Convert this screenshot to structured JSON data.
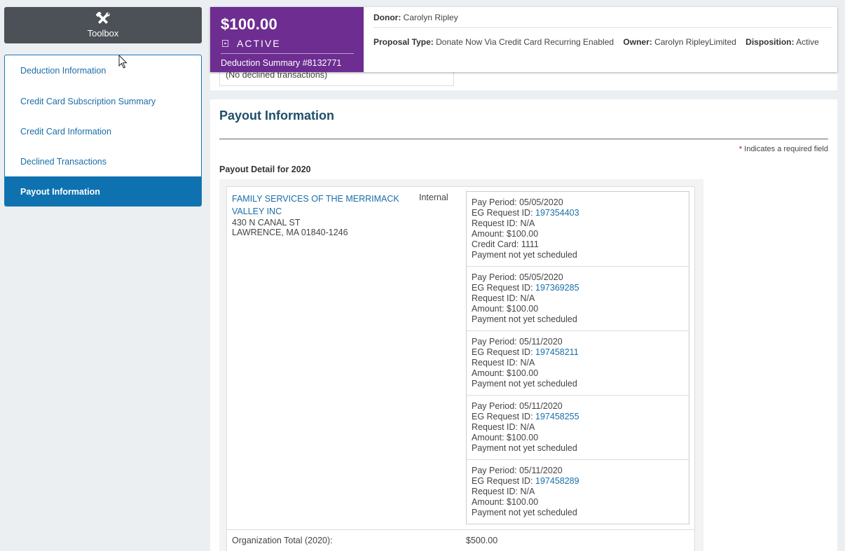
{
  "toolbox": {
    "label": "Toolbox"
  },
  "sidebar": {
    "items": [
      {
        "label": "Deduction Information",
        "active": false
      },
      {
        "label": "Credit Card Subscription Summary",
        "active": false
      },
      {
        "label": "Credit Card Information",
        "active": false
      },
      {
        "label": "Declined Transactions",
        "active": false
      },
      {
        "label": "Payout Information",
        "active": true
      }
    ]
  },
  "summary": {
    "amount": "$100.00",
    "status": "ACTIVE",
    "deduction_label": "Deduction Summary",
    "deduction_id": "#8132771",
    "donor_label": "Donor:",
    "donor": "Carolyn Ripley",
    "proposal_type_label": "Proposal Type:",
    "proposal_type": "Donate Now Via Credit Card Recurring Enabled",
    "owner_label": "Owner:",
    "owner": "Carolyn RipleyLimited",
    "disposition_label": "Disposition:",
    "disposition": "Active"
  },
  "declined": {
    "message": "(No declined transactions)"
  },
  "payout": {
    "title": "Payout Information",
    "required_note": "Indicates a required field",
    "required_star": "*",
    "detail_title": "Payout Detail for 2020",
    "org": {
      "name": "FAMILY SERVICES OF THE MERRIMACK VALLEY INC",
      "address_line1": "430 N CANAL ST",
      "address_line2": "LAWRENCE, MA 01840-1246",
      "type": "Internal"
    },
    "periods": [
      {
        "pay_period": "Pay Period: 05/05/2020",
        "eg_label": "EG Request ID: ",
        "eg_id": "197354403",
        "request_id": "Request ID: N/A",
        "amount": "Amount: $100.00",
        "credit_card": "Credit Card: 1111",
        "status": "Payment not yet scheduled"
      },
      {
        "pay_period": "Pay Period: 05/05/2020",
        "eg_label": "EG Request ID: ",
        "eg_id": "197369285",
        "request_id": "Request ID: N/A",
        "amount": "Amount: $100.00",
        "status": "Payment not yet scheduled"
      },
      {
        "pay_period": "Pay Period: 05/11/2020",
        "eg_label": "EG Request ID: ",
        "eg_id": "197458211",
        "request_id": "Request ID: N/A",
        "amount": "Amount: $100.00",
        "status": "Payment not yet scheduled"
      },
      {
        "pay_period": "Pay Period: 05/11/2020",
        "eg_label": "EG Request ID: ",
        "eg_id": "197458255",
        "request_id": "Request ID: N/A",
        "amount": "Amount: $100.00",
        "status": "Payment not yet scheduled"
      },
      {
        "pay_period": "Pay Period: 05/11/2020",
        "eg_label": "EG Request ID: ",
        "eg_id": "197458289",
        "request_id": "Request ID: N/A",
        "amount": "Amount: $100.00",
        "status": "Payment not yet scheduled"
      }
    ],
    "total_label": "Organization Total (2020):",
    "total_value": "$500.00"
  },
  "icons": {
    "toolbox": "tools-icon",
    "status": "status-icon",
    "cursor": "mouse-cursor-icon"
  },
  "colors": {
    "accent": "#0f72b0",
    "summary_purple": "#6d2d91",
    "toolbox_bg": "#4c5057",
    "link": "#1a6ea8"
  }
}
